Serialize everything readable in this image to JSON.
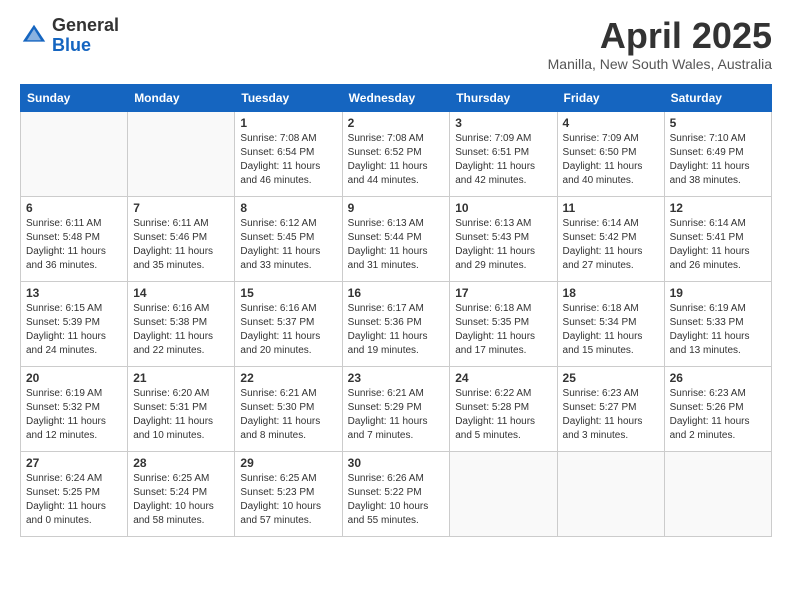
{
  "header": {
    "logo_general": "General",
    "logo_blue": "Blue",
    "month_title": "April 2025",
    "location": "Manilla, New South Wales, Australia"
  },
  "days_of_week": [
    "Sunday",
    "Monday",
    "Tuesday",
    "Wednesday",
    "Thursday",
    "Friday",
    "Saturday"
  ],
  "weeks": [
    [
      {
        "day": "",
        "info": ""
      },
      {
        "day": "",
        "info": ""
      },
      {
        "day": "1",
        "info": "Sunrise: 7:08 AM\nSunset: 6:54 PM\nDaylight: 11 hours and 46 minutes."
      },
      {
        "day": "2",
        "info": "Sunrise: 7:08 AM\nSunset: 6:52 PM\nDaylight: 11 hours and 44 minutes."
      },
      {
        "day": "3",
        "info": "Sunrise: 7:09 AM\nSunset: 6:51 PM\nDaylight: 11 hours and 42 minutes."
      },
      {
        "day": "4",
        "info": "Sunrise: 7:09 AM\nSunset: 6:50 PM\nDaylight: 11 hours and 40 minutes."
      },
      {
        "day": "5",
        "info": "Sunrise: 7:10 AM\nSunset: 6:49 PM\nDaylight: 11 hours and 38 minutes."
      }
    ],
    [
      {
        "day": "6",
        "info": "Sunrise: 6:11 AM\nSunset: 5:48 PM\nDaylight: 11 hours and 36 minutes."
      },
      {
        "day": "7",
        "info": "Sunrise: 6:11 AM\nSunset: 5:46 PM\nDaylight: 11 hours and 35 minutes."
      },
      {
        "day": "8",
        "info": "Sunrise: 6:12 AM\nSunset: 5:45 PM\nDaylight: 11 hours and 33 minutes."
      },
      {
        "day": "9",
        "info": "Sunrise: 6:13 AM\nSunset: 5:44 PM\nDaylight: 11 hours and 31 minutes."
      },
      {
        "day": "10",
        "info": "Sunrise: 6:13 AM\nSunset: 5:43 PM\nDaylight: 11 hours and 29 minutes."
      },
      {
        "day": "11",
        "info": "Sunrise: 6:14 AM\nSunset: 5:42 PM\nDaylight: 11 hours and 27 minutes."
      },
      {
        "day": "12",
        "info": "Sunrise: 6:14 AM\nSunset: 5:41 PM\nDaylight: 11 hours and 26 minutes."
      }
    ],
    [
      {
        "day": "13",
        "info": "Sunrise: 6:15 AM\nSunset: 5:39 PM\nDaylight: 11 hours and 24 minutes."
      },
      {
        "day": "14",
        "info": "Sunrise: 6:16 AM\nSunset: 5:38 PM\nDaylight: 11 hours and 22 minutes."
      },
      {
        "day": "15",
        "info": "Sunrise: 6:16 AM\nSunset: 5:37 PM\nDaylight: 11 hours and 20 minutes."
      },
      {
        "day": "16",
        "info": "Sunrise: 6:17 AM\nSunset: 5:36 PM\nDaylight: 11 hours and 19 minutes."
      },
      {
        "day": "17",
        "info": "Sunrise: 6:18 AM\nSunset: 5:35 PM\nDaylight: 11 hours and 17 minutes."
      },
      {
        "day": "18",
        "info": "Sunrise: 6:18 AM\nSunset: 5:34 PM\nDaylight: 11 hours and 15 minutes."
      },
      {
        "day": "19",
        "info": "Sunrise: 6:19 AM\nSunset: 5:33 PM\nDaylight: 11 hours and 13 minutes."
      }
    ],
    [
      {
        "day": "20",
        "info": "Sunrise: 6:19 AM\nSunset: 5:32 PM\nDaylight: 11 hours and 12 minutes."
      },
      {
        "day": "21",
        "info": "Sunrise: 6:20 AM\nSunset: 5:31 PM\nDaylight: 11 hours and 10 minutes."
      },
      {
        "day": "22",
        "info": "Sunrise: 6:21 AM\nSunset: 5:30 PM\nDaylight: 11 hours and 8 minutes."
      },
      {
        "day": "23",
        "info": "Sunrise: 6:21 AM\nSunset: 5:29 PM\nDaylight: 11 hours and 7 minutes."
      },
      {
        "day": "24",
        "info": "Sunrise: 6:22 AM\nSunset: 5:28 PM\nDaylight: 11 hours and 5 minutes."
      },
      {
        "day": "25",
        "info": "Sunrise: 6:23 AM\nSunset: 5:27 PM\nDaylight: 11 hours and 3 minutes."
      },
      {
        "day": "26",
        "info": "Sunrise: 6:23 AM\nSunset: 5:26 PM\nDaylight: 11 hours and 2 minutes."
      }
    ],
    [
      {
        "day": "27",
        "info": "Sunrise: 6:24 AM\nSunset: 5:25 PM\nDaylight: 11 hours and 0 minutes."
      },
      {
        "day": "28",
        "info": "Sunrise: 6:25 AM\nSunset: 5:24 PM\nDaylight: 10 hours and 58 minutes."
      },
      {
        "day": "29",
        "info": "Sunrise: 6:25 AM\nSunset: 5:23 PM\nDaylight: 10 hours and 57 minutes."
      },
      {
        "day": "30",
        "info": "Sunrise: 6:26 AM\nSunset: 5:22 PM\nDaylight: 10 hours and 55 minutes."
      },
      {
        "day": "",
        "info": ""
      },
      {
        "day": "",
        "info": ""
      },
      {
        "day": "",
        "info": ""
      }
    ]
  ]
}
